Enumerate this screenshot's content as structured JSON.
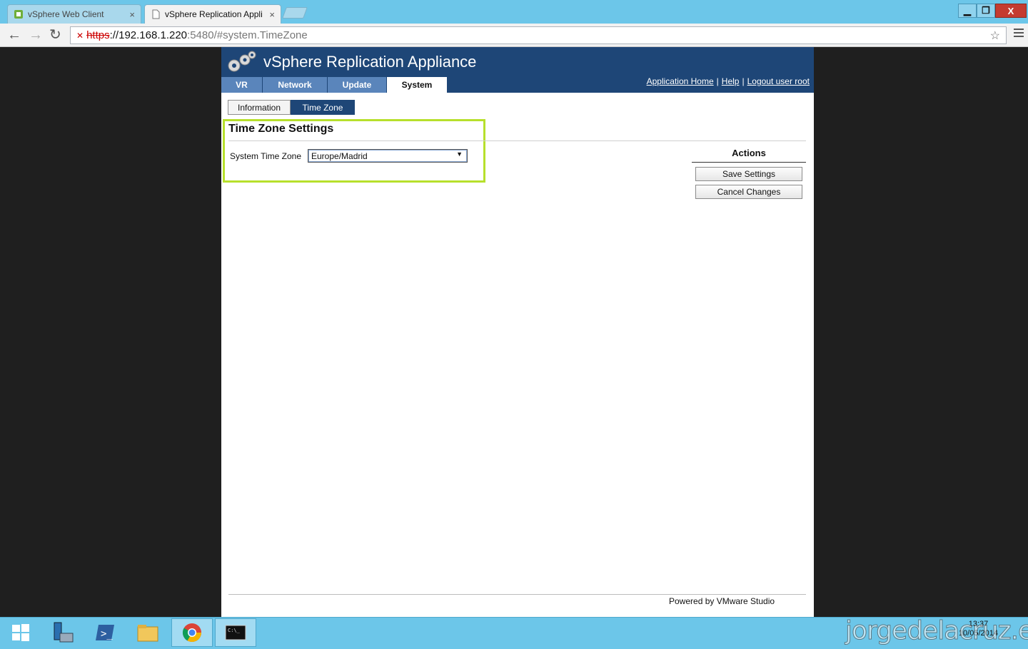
{
  "browser": {
    "tabs": [
      {
        "label": "vSphere Web Client",
        "active": false
      },
      {
        "label": "vSphere Replication Appli",
        "active": true
      }
    ],
    "address": {
      "scheme": "https",
      "host": "://192.168.1.220",
      "rest": ":5480/#system.TimeZone"
    },
    "window_controls": {
      "minimize": "▁",
      "restore": "❐",
      "close": "X"
    }
  },
  "app": {
    "title": "vSphere Replication Appliance",
    "nav_tabs": [
      {
        "label": "VR"
      },
      {
        "label": "Network"
      },
      {
        "label": "Update"
      },
      {
        "label": "System",
        "active": true
      }
    ],
    "links": {
      "home": "Application Home",
      "help": "Help",
      "logout": "Logout user root",
      "separator": "|"
    },
    "sub_tabs": [
      {
        "label": "Information"
      },
      {
        "label": "Time Zone",
        "active": true
      }
    ],
    "section_title": "Time Zone Settings",
    "timezone": {
      "label": "System Time Zone",
      "value": "Europe/Madrid"
    },
    "actions": {
      "title": "Actions",
      "save": "Save Settings",
      "cancel": "Cancel Changes"
    },
    "footer": "Powered by VMware Studio"
  },
  "taskbar": {
    "items": [
      "windows-start-icon",
      "server-manager-icon",
      "powershell-icon",
      "file-explorer-icon",
      "chrome-icon",
      "cmd-icon"
    ],
    "clock_time": "13:37",
    "clock_date": "10/05/2014"
  },
  "watermark": "jorgedelacruz.es",
  "colors": {
    "banner": "#1e4677",
    "nav_tab": "#5a85bb",
    "highlight": "#b7e02c",
    "chrome": "#6cc6e9"
  }
}
